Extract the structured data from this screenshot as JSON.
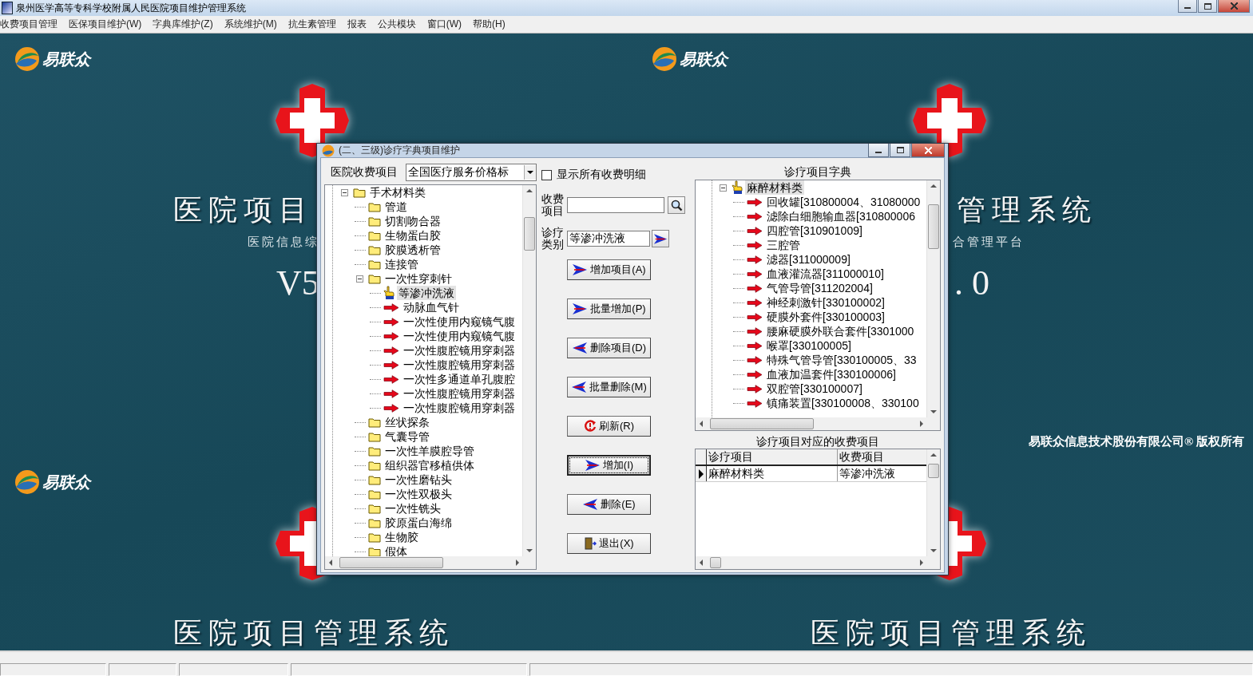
{
  "window": {
    "title": "泉州医学高等专科学校附属人民医院项目维护管理系统"
  },
  "menu": [
    "收费项目管理",
    "医保项目维护(W)",
    "字典库维护(Z)",
    "系统维护(M)",
    "抗生素管理",
    "报表",
    "公共模块",
    "窗口(W)",
    "帮助(H)"
  ],
  "wallpaper": {
    "tiles": [
      {
        "logo": "易联众",
        "title": "医院项目",
        "subtitle": "医院信息综",
        "version": "V5"
      },
      {
        "logo": "易联众",
        "title_tail": "管理系统",
        "subtitle_tail": "合管理平台",
        "version_tail": ". 0",
        "copyright": "易联众信息技术股份有限公司® 版权所有"
      },
      {
        "logo": "易联众",
        "title": "医院项目管理系统"
      },
      {
        "title": "医院项目管理系统"
      }
    ]
  },
  "dialog": {
    "title": "(二、三级)诊疗字典项目维护",
    "source_label": "医院收费项目",
    "source_combo": "全国医疗服务价格标",
    "show_all": {
      "label": "显示所有收费明细",
      "checked": false
    },
    "left_tree": [
      {
        "label": "手术材料类",
        "kind": "folder",
        "selected": false,
        "expanded": true,
        "children": [
          {
            "label": "管道",
            "kind": "folder",
            "selected": false
          },
          {
            "label": "切割吻合器",
            "kind": "folder",
            "selected": false
          },
          {
            "label": "生物蛋白胶",
            "kind": "folder",
            "selected": false
          },
          {
            "label": "胶膜透析管",
            "kind": "folder",
            "selected": false
          },
          {
            "label": "连接管",
            "kind": "folder",
            "selected": false
          },
          {
            "label": "一次性穿刺针",
            "kind": "folder",
            "selected": false,
            "expanded": true,
            "children": [
              {
                "label": "等渗冲洗液",
                "kind": "hand",
                "selected": true
              },
              {
                "label": "动脉血气针",
                "kind": "arrow",
                "selected": false
              },
              {
                "label": "一次性使用内窥镜气腹",
                "kind": "arrow",
                "selected": false
              },
              {
                "label": "一次性使用内窥镜气腹",
                "kind": "arrow",
                "selected": false
              },
              {
                "label": "一次性腹腔镜用穿刺器",
                "kind": "arrow",
                "selected": false
              },
              {
                "label": "一次性腹腔镜用穿刺器",
                "kind": "arrow",
                "selected": false
              },
              {
                "label": "一次性多通道单孔腹腔",
                "kind": "arrow",
                "selected": false
              },
              {
                "label": "一次性腹腔镜用穿刺器",
                "kind": "arrow",
                "selected": false
              },
              {
                "label": "一次性腹腔镜用穿刺器",
                "kind": "arrow",
                "selected": false
              }
            ]
          },
          {
            "label": "丝状探条",
            "kind": "folder",
            "selected": false
          },
          {
            "label": "气囊导管",
            "kind": "folder",
            "selected": false
          },
          {
            "label": "一次性羊膜腔导管",
            "kind": "folder",
            "selected": false
          },
          {
            "label": "组织器官移植供体",
            "kind": "folder",
            "selected": false
          },
          {
            "label": "一次性磨钻头",
            "kind": "folder",
            "selected": false
          },
          {
            "label": "一次性双极头",
            "kind": "folder",
            "selected": false
          },
          {
            "label": "一次性铣头",
            "kind": "folder",
            "selected": false
          },
          {
            "label": "胶原蛋白海绵",
            "kind": "folder",
            "selected": false
          },
          {
            "label": "生物胶",
            "kind": "folder",
            "selected": false
          },
          {
            "label": "假体",
            "kind": "folder",
            "selected": false
          }
        ]
      }
    ],
    "charge_label": "收费项目",
    "category_label": "诊疗类别",
    "category_value": "等渗冲洗液",
    "buttons": [
      {
        "label": "增加项目(A)",
        "kind": "add",
        "focused": false
      },
      {
        "label": "批量增加(P)",
        "kind": "add",
        "focused": false
      },
      {
        "label": "删除项目(D)",
        "kind": "remove",
        "focused": false
      },
      {
        "label": "批量删除(M)",
        "kind": "remove",
        "focused": false
      },
      {
        "label": "刷新(R)",
        "kind": "refresh",
        "focused": false
      },
      {
        "label": "增加(I)",
        "kind": "add",
        "focused": true
      },
      {
        "label": "删除(E)",
        "kind": "remove",
        "focused": false
      },
      {
        "label": "退出(X)",
        "kind": "exit",
        "focused": false
      }
    ],
    "dict_title": "诊疗项目字典",
    "right_tree": [
      {
        "label": "麻醉材料类",
        "kind": "hand",
        "selected": true,
        "expanded": true,
        "children": [
          {
            "label": "回收罐[310800004、31080000",
            "kind": "arrow",
            "selected": false
          },
          {
            "label": "滤除白细胞输血器[310800006",
            "kind": "arrow",
            "selected": false
          },
          {
            "label": "四腔管[310901009]",
            "kind": "arrow",
            "selected": false
          },
          {
            "label": "三腔管",
            "kind": "arrow",
            "selected": false
          },
          {
            "label": "滤器[311000009]",
            "kind": "arrow",
            "selected": false
          },
          {
            "label": "血液灌流器[311000010]",
            "kind": "arrow",
            "selected": false
          },
          {
            "label": "气管导管[311202004]",
            "kind": "arrow",
            "selected": false
          },
          {
            "label": "神经刺激针[330100002]",
            "kind": "arrow",
            "selected": false
          },
          {
            "label": "硬膜外套件[330100003]",
            "kind": "arrow",
            "selected": false
          },
          {
            "label": "腰麻硬膜外联合套件[3301000",
            "kind": "arrow",
            "selected": false
          },
          {
            "label": "喉罩[330100005]",
            "kind": "arrow",
            "selected": false
          },
          {
            "label": "特殊气管导管[330100005、33",
            "kind": "arrow",
            "selected": false
          },
          {
            "label": "血液加温套件[330100006]",
            "kind": "arrow",
            "selected": false
          },
          {
            "label": "双腔管[330100007]",
            "kind": "arrow",
            "selected": false
          },
          {
            "label": "镇痛装置[330100008、330100",
            "kind": "arrow",
            "selected": false
          }
        ]
      }
    ],
    "mapping_title": "诊疗项目对应的收费项目",
    "mapping": {
      "columns": [
        "诊疗项目",
        "收费项目"
      ],
      "rows": [
        {
          "cells": [
            "麻醉材料类",
            "等渗冲洗液"
          ],
          "selected": true
        }
      ]
    }
  }
}
